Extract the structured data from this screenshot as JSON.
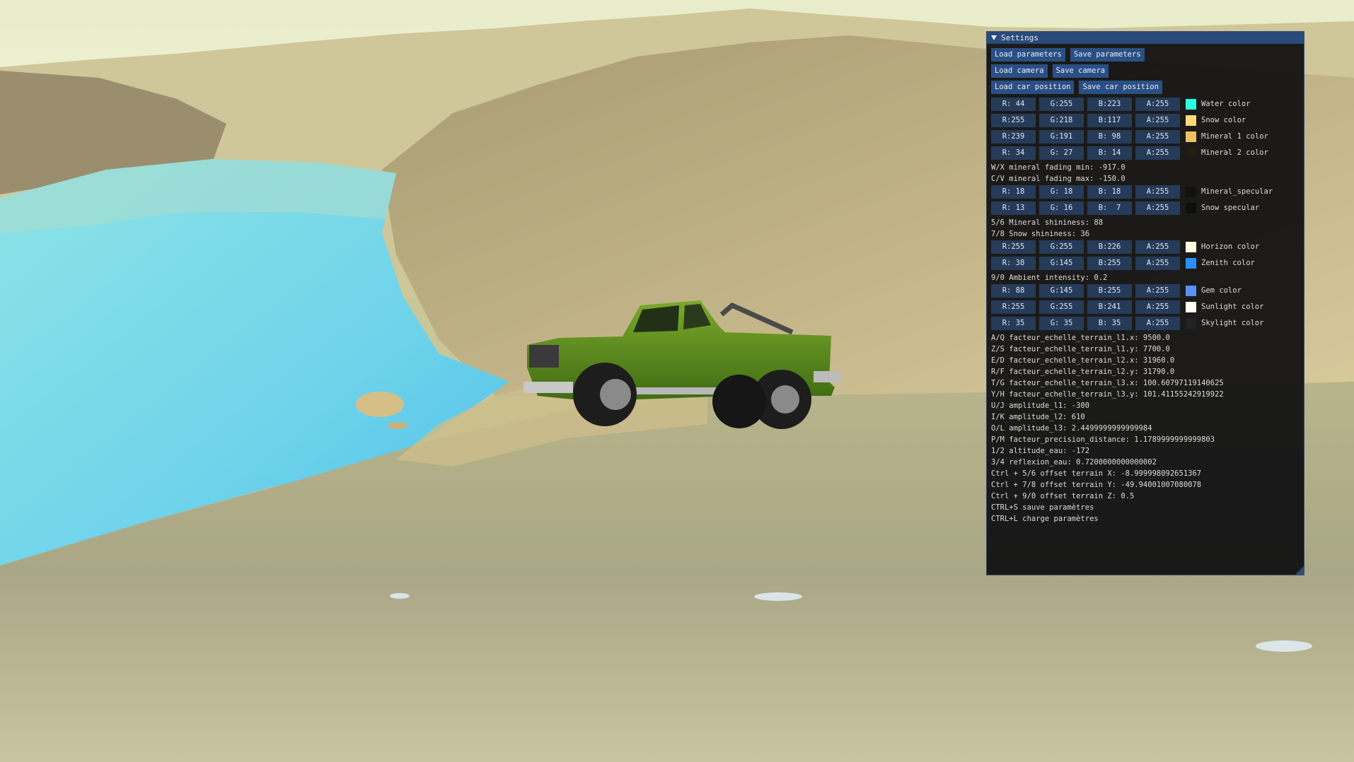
{
  "panel": {
    "title": "Settings",
    "buttons": [
      [
        "Load parameters",
        "Save parameters"
      ],
      [
        "Load camera",
        "Save camera"
      ],
      [
        "Load car position",
        "Save car position"
      ]
    ],
    "rows": [
      {
        "kind": "color",
        "r": "R: 44",
        "g": "G:255",
        "b": "B:223",
        "a": "A:255",
        "swatch": "#2cffdf",
        "label": "Water color"
      },
      {
        "kind": "color",
        "r": "R:255",
        "g": "G:218",
        "b": "B:117",
        "a": "A:255",
        "swatch": "#ffda75",
        "label": "Snow color"
      },
      {
        "kind": "color",
        "r": "R:239",
        "g": "G:191",
        "b": "B: 98",
        "a": "A:255",
        "swatch": "#efbf62",
        "label": "Mineral 1 color"
      },
      {
        "kind": "color",
        "r": "R: 34",
        "g": "G: 27",
        "b": "B: 14",
        "a": "A:255",
        "swatch": "#221b0e",
        "label": "Mineral 2 color"
      },
      {
        "kind": "text",
        "text": "W/X mineral fading min: -917.0"
      },
      {
        "kind": "text",
        "text": "C/V mineral fading max: -150.0"
      },
      {
        "kind": "color",
        "r": "R: 18",
        "g": "G: 18",
        "b": "B: 18",
        "a": "A:255",
        "swatch": "#121212",
        "label": "Mineral_specular"
      },
      {
        "kind": "color",
        "r": "R: 13",
        "g": "G: 16",
        "b": "B:  7",
        "a": "A:255",
        "swatch": "#0d1007",
        "label": "Snow specular"
      },
      {
        "kind": "text",
        "text": "5/6 Mineral shininess: 88"
      },
      {
        "kind": "text",
        "text": "7/8 Snow shininess: 36"
      },
      {
        "kind": "color",
        "r": "R:255",
        "g": "G:255",
        "b": "B:226",
        "a": "A:255",
        "swatch": "#ffffe2",
        "label": "Horizon color"
      },
      {
        "kind": "color",
        "r": "R: 38",
        "g": "G:145",
        "b": "B:255",
        "a": "A:255",
        "swatch": "#2691ff",
        "label": "Zenith color"
      },
      {
        "kind": "text",
        "text": "9/0 Ambient intensity: 0.2"
      },
      {
        "kind": "color",
        "r": "R: 88",
        "g": "G:145",
        "b": "B:255",
        "a": "A:255",
        "swatch": "#5891ff",
        "label": "Gem color"
      },
      {
        "kind": "color",
        "r": "R:255",
        "g": "G:255",
        "b": "B:241",
        "a": "A:255",
        "swatch": "#fffff1",
        "label": "Sunlight color"
      },
      {
        "kind": "color",
        "r": "R: 35",
        "g": "G: 35",
        "b": "B: 35",
        "a": "A:255",
        "swatch": "#232323",
        "label": "Skylight color"
      },
      {
        "kind": "text",
        "text": "A/Q facteur_echelle_terrain_l1.x: 9500.0"
      },
      {
        "kind": "text",
        "text": "Z/S facteur_echelle_terrain_l1.y: 7700.0"
      },
      {
        "kind": "text",
        "text": "E/D facteur_echelle_terrain_l2.x: 31960.0"
      },
      {
        "kind": "text",
        "text": "R/F facteur_echelle_terrain_l2.y: 31790.0"
      },
      {
        "kind": "text",
        "text": "T/G facteur_echelle_terrain_l3.x: 100.60797119140625"
      },
      {
        "kind": "text",
        "text": "Y/H facteur_echelle_terrain_l3.y: 101.41155242919922"
      },
      {
        "kind": "text",
        "text": "U/J amplitude_l1: -300"
      },
      {
        "kind": "text",
        "text": "I/K amplitude_l2: 610"
      },
      {
        "kind": "text",
        "text": "O/L amplitude_l3: 2.4499999999999984"
      },
      {
        "kind": "text",
        "text": "P/M facteur_precision_distance: 1.1789999999999803"
      },
      {
        "kind": "text",
        "text": "1/2 altitude_eau: -172"
      },
      {
        "kind": "text",
        "text": "3/4 reflexion_eau: 0.7200000000000002"
      },
      {
        "kind": "text",
        "text": "Ctrl + 5/6 offset terrain X: -8.999998092651367"
      },
      {
        "kind": "text",
        "text": "Ctrl + 7/8 offset terrain Y: -49.94001007080078"
      },
      {
        "kind": "text",
        "text": "Ctrl + 9/0 offset terrain Z: 0.5"
      },
      {
        "kind": "text",
        "text": "CTRL+S sauve paramètres"
      },
      {
        "kind": "text",
        "text": "CTRL+L charge paramètres"
      }
    ]
  },
  "scene": {
    "sky_color": "#f0f2dc",
    "water_color": "#7fdde8",
    "terrain_color": "#bdb888",
    "car_body_color": "#5a8a1e"
  }
}
